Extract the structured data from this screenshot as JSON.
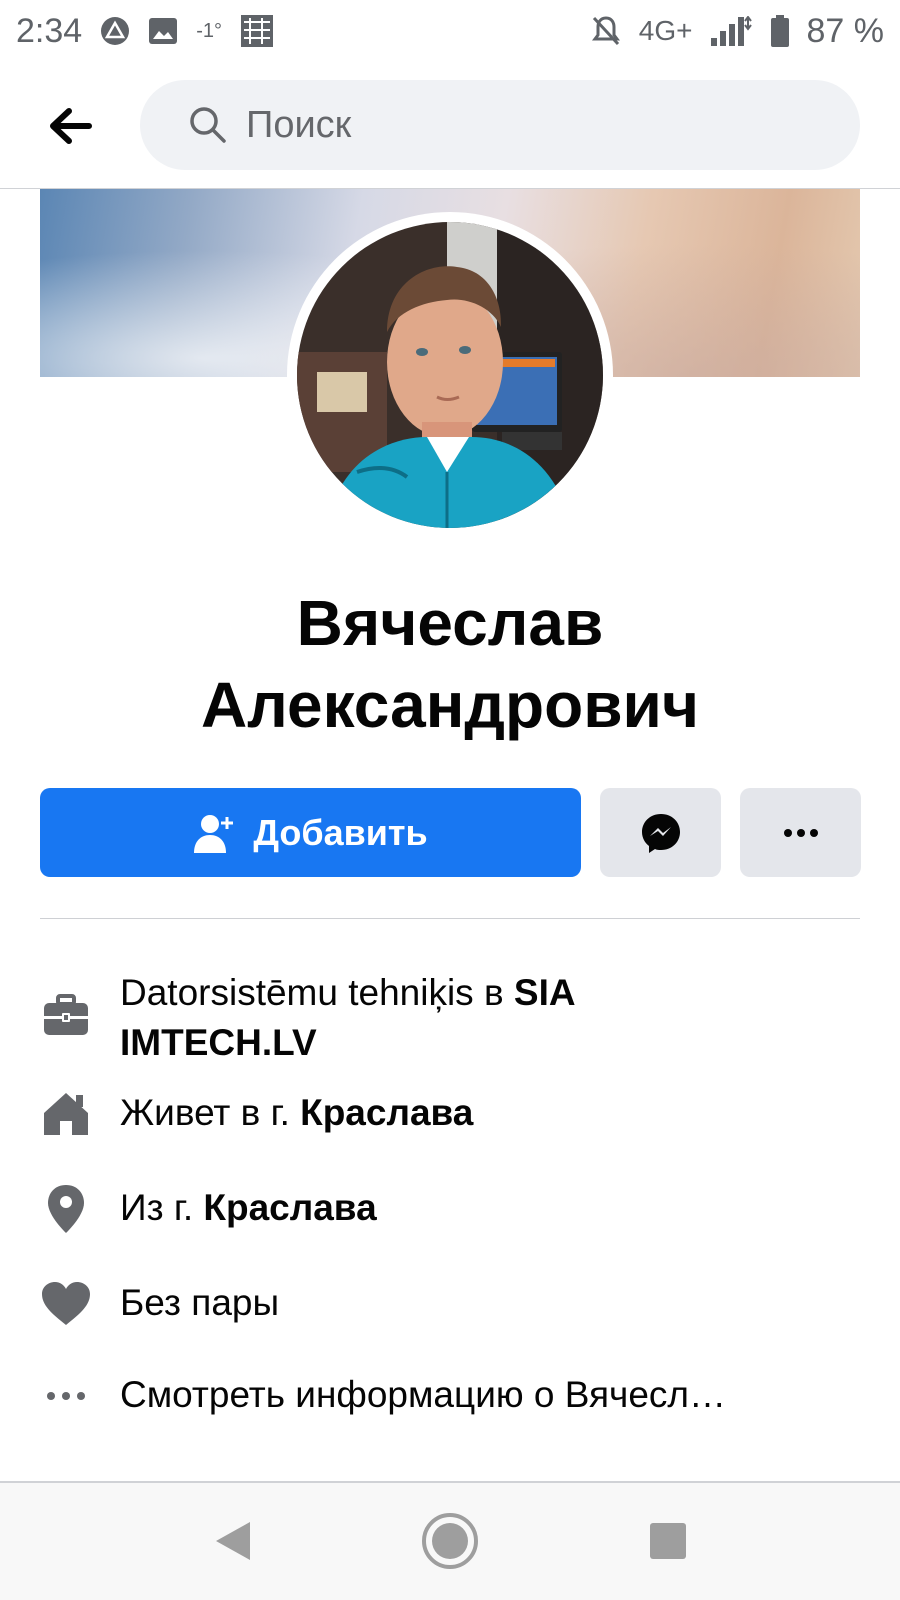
{
  "status_bar": {
    "time": "2:34",
    "temp": "-1°",
    "network": "4G+",
    "battery": "87 %"
  },
  "header": {
    "search_placeholder": "Поиск"
  },
  "profile": {
    "name_line1": "Вячеслав",
    "name_line2": "Александрович"
  },
  "actions": {
    "add_label": "Добавить"
  },
  "info": {
    "work_prefix": "Datorsistēmu tehniķis в ",
    "work_company_1": "SIA",
    "work_company_2": "IMTECH.LV",
    "lives_prefix": "Живет в г. ",
    "lives_city": "Краслава",
    "from_prefix": "Из г. ",
    "from_city": "Краслава",
    "relationship": "Без пары",
    "see_more": "Смотреть информацию о Вячесл…"
  },
  "colors": {
    "primary": "#1877f2",
    "button_gray": "#e4e6eb",
    "icon_gray": "#65676b",
    "text": "#050505"
  }
}
